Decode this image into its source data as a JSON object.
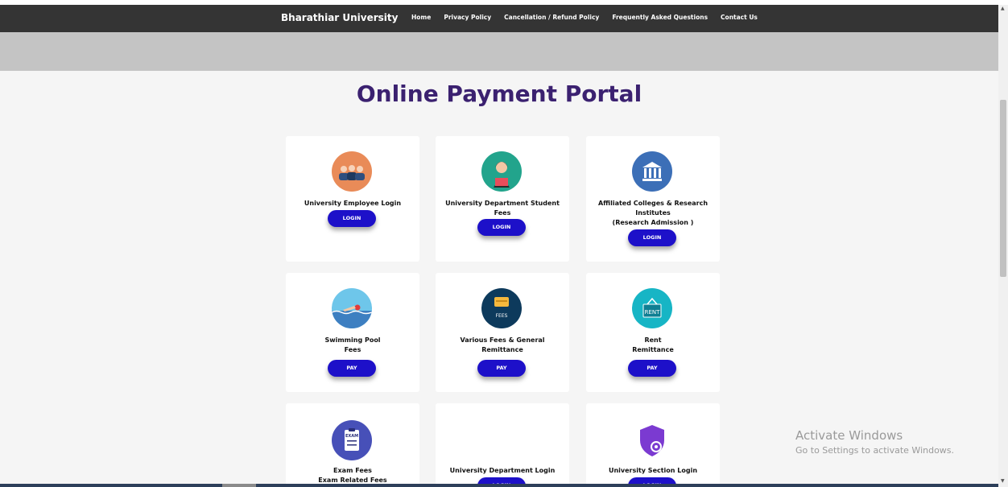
{
  "navbar": {
    "brand": "Bharathiar University",
    "links": [
      "Home",
      "Privacy Policy",
      "Cancellation / Refund Policy",
      "Frequently Asked Questions",
      "Contact Us"
    ]
  },
  "page_title": "Online Payment Portal",
  "cards": [
    {
      "title": "University Employee Login",
      "button": "LOGIN",
      "icon": "employees-icon",
      "icon_color": "#e98b58"
    },
    {
      "title": "University Department Student\nFees",
      "button": "LOGIN",
      "icon": "student-icon",
      "icon_color": "#22a48c"
    },
    {
      "title": "Affiliated Colleges & Research\nInstitutes\n(Research Admission )",
      "button": "LOGIN",
      "icon": "building-icon",
      "icon_color": "#3c6fb7"
    },
    {
      "title": "Swimming Pool\nFees",
      "button": "PAY",
      "icon": "swimmer-icon",
      "icon_color": "#6ec6ea"
    },
    {
      "title": "Various Fees & General\nRemittance",
      "button": "PAY",
      "icon": "fees-icon",
      "icon_color": "#0d3a5c"
    },
    {
      "title": "Rent\nRemittance",
      "button": "PAY",
      "icon": "rent-sign-icon",
      "icon_color": "#17b5c5"
    },
    {
      "title": "Exam Fees\nExam Related Fees",
      "button": "",
      "icon": "exam-icon",
      "icon_color": "#4750b8"
    },
    {
      "title": "University Department Login",
      "button": "LOGIN",
      "icon": "",
      "icon_color": ""
    },
    {
      "title": "University Section Login",
      "button": "LOGIN",
      "icon": "shield-icon",
      "icon_color": "#7b3ad1"
    }
  ],
  "icon_labels": {
    "exam": "EXAM",
    "fees": "FEES",
    "rent": "RENT"
  },
  "watermark": {
    "line1": "Activate Windows",
    "line2": "Go to Settings to activate Windows."
  },
  "colors": {
    "navbar": "#343434",
    "button": "#1d10c9",
    "title": "#3b2170"
  }
}
